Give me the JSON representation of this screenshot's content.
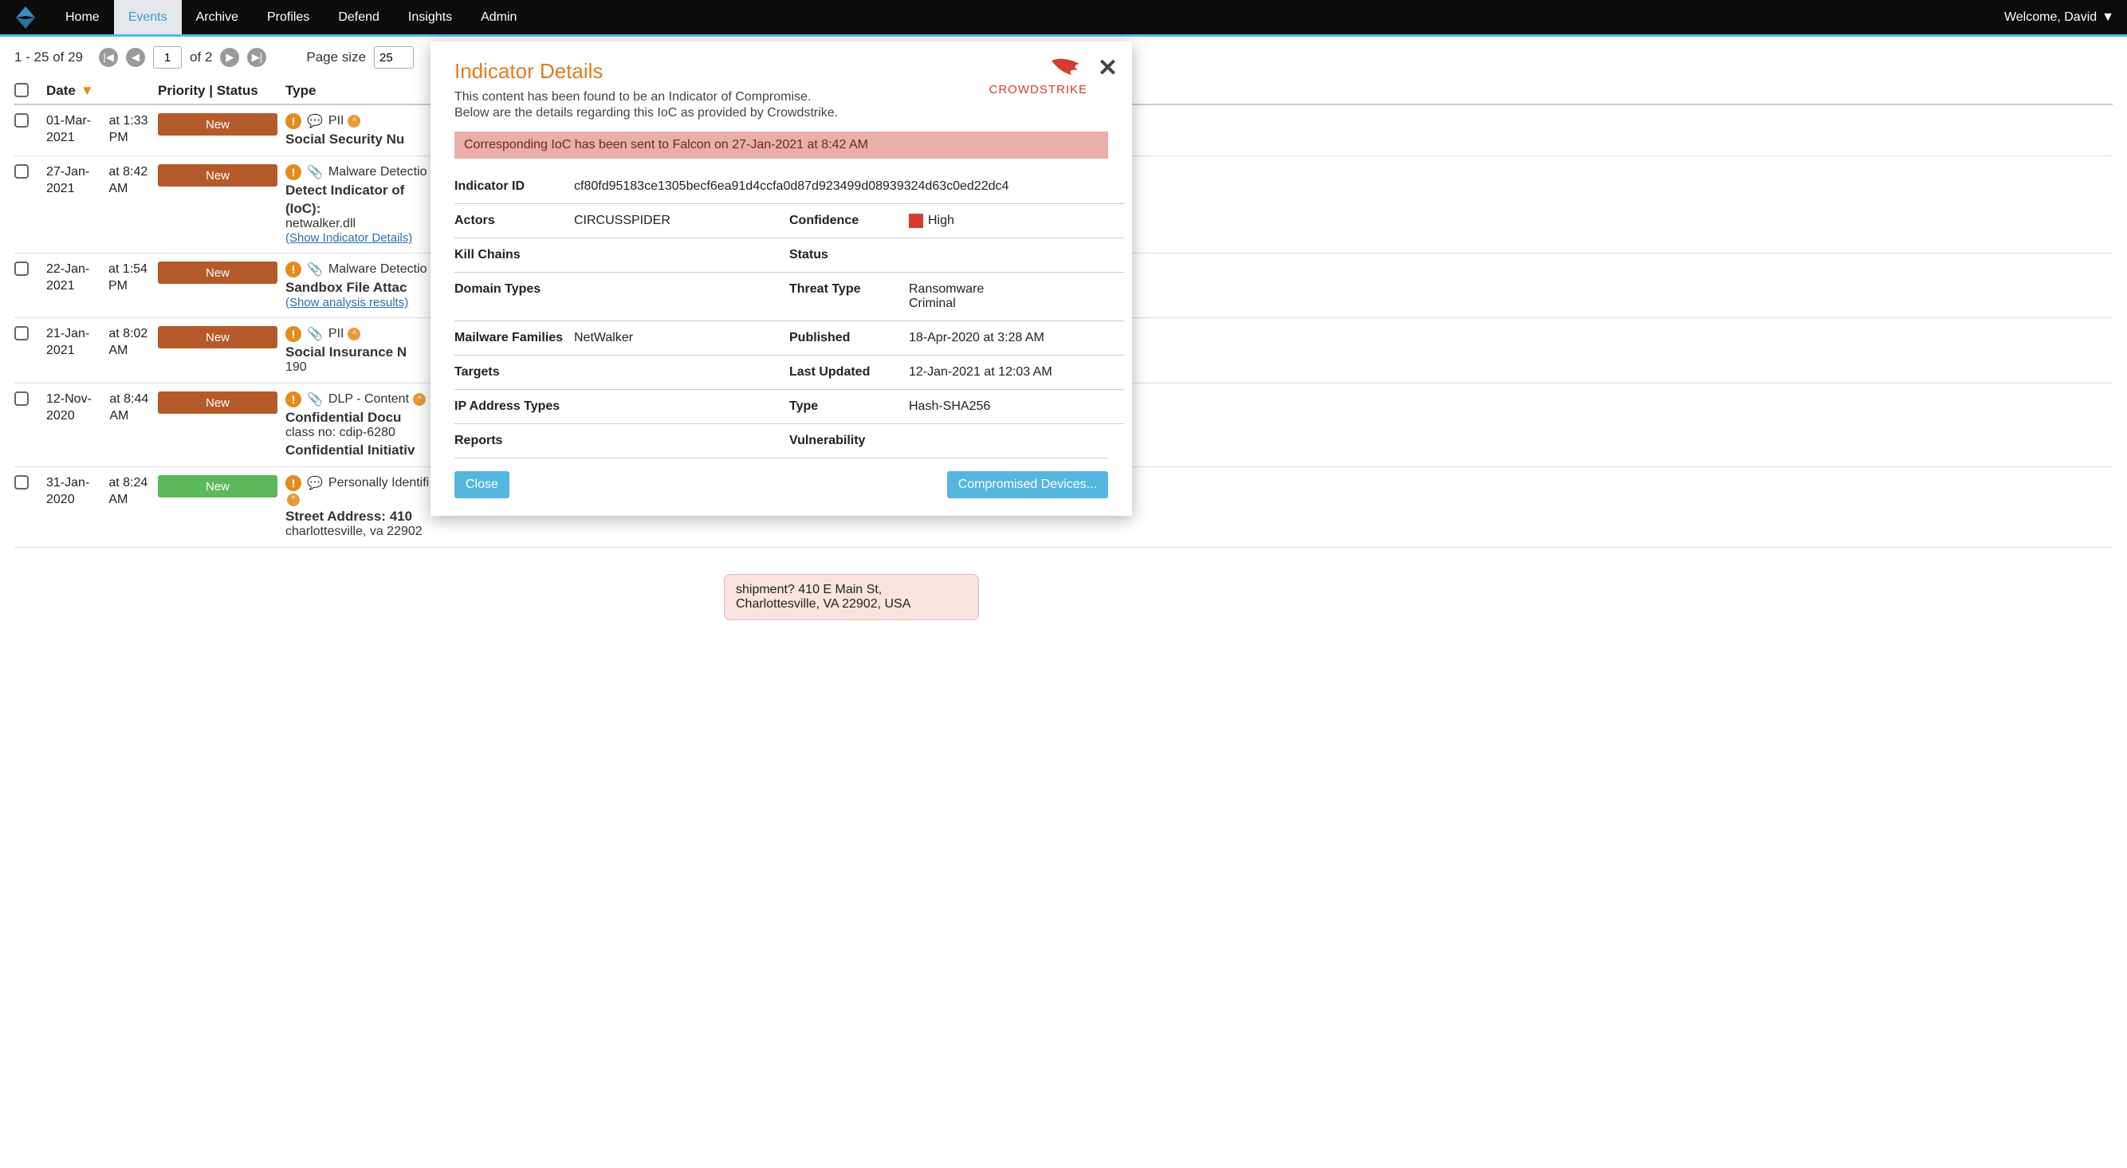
{
  "header": {
    "nav": [
      "Home",
      "Events",
      "Archive",
      "Profiles",
      "Defend",
      "Insights",
      "Admin"
    ],
    "active_nav": "Events",
    "welcome": "Welcome, David"
  },
  "pager": {
    "range": "1 - 25 of 29",
    "current_page": "1",
    "of_pages": "of 2",
    "page_size_label": "Page size",
    "page_size_value": "25"
  },
  "columns": {
    "date": "Date",
    "priority": "Priority | Status",
    "type": "Type"
  },
  "rows": [
    {
      "date1": "01-Mar-2021",
      "date2": "at 1:33 PM",
      "status": "New",
      "status_color": "brown",
      "icons": {
        "bubble": true
      },
      "tag": "PII",
      "chev": true,
      "title": "Social Security Nu",
      "line3": "",
      "link": ""
    },
    {
      "date1": "27-Jan-2021",
      "date2": "at 8:42 AM",
      "status": "New",
      "status_color": "brown",
      "icons": {
        "clip": true
      },
      "tag": "Malware Detectio",
      "title": "Detect Indicator of",
      "title2": "(IoC):",
      "line3": "netwalker.dll",
      "link": "(Show Indicator Details)"
    },
    {
      "date1": "22-Jan-2021",
      "date2": "at 1:54 PM",
      "status": "New",
      "status_color": "brown",
      "icons": {
        "clip": true
      },
      "tag": "Malware Detectio",
      "title": "Sandbox File Attac",
      "link": "(Show analysis results)"
    },
    {
      "date1": "21-Jan-2021",
      "date2": "at 8:02 AM",
      "status": "New",
      "status_color": "brown",
      "icons": {
        "clip": true
      },
      "tag": "PII",
      "chev": true,
      "title": "Social Insurance N",
      "line3": "190"
    },
    {
      "date1": "12-Nov-2020",
      "date2": "at 8:44 AM",
      "status": "New",
      "status_color": "brown",
      "icons": {
        "clip": true
      },
      "tag": "DLP - Content",
      "chev": true,
      "title": "Confidential Docu",
      "line3": "class no: cdip-6280",
      "title3": "Confidential Initiativ"
    },
    {
      "date1": "31-Jan-2020",
      "date2": "at 8:24 AM",
      "status": "New",
      "status_color": "green",
      "icons": {
        "bubble": true
      },
      "tag": "Personally Identifi",
      "chev_below": true,
      "title": "Street Address: 410",
      "line3": "charlottesville, va 22902"
    }
  ],
  "excerpt": "shipment? 410 E Main St, Charlottesville, VA 22902, USA",
  "modal": {
    "title": "Indicator Details",
    "sub1": "This content has been found to be an Indicator of Compromise.",
    "sub2": "Below are the details regarding this IoC as provided by Crowdstrike.",
    "brand": "CROWDSTRIKE",
    "banner": "Corresponding IoC has been sent to Falcon on 27-Jan-2021 at 8:42 AM",
    "details": {
      "indicator_id_label": "Indicator ID",
      "indicator_id": "cf80fd95183ce1305becf6ea91d4ccfa0d87d923499d08939324d63c0ed22dc4",
      "actors_label": "Actors",
      "actors": "CIRCUSSPIDER",
      "confidence_label": "Confidence",
      "confidence": "High",
      "kill_label": "Kill Chains",
      "kill": "",
      "status_label": "Status",
      "status": "",
      "domain_label": "Domain Types",
      "domain": "",
      "threat_label": "Threat Type",
      "threat": "Ransomware\nCriminal",
      "families_label": "Mailware Families",
      "families": "NetWalker",
      "published_label": "Published",
      "published": "18-Apr-2020 at 3:28 AM",
      "targets_label": "Targets",
      "targets": "",
      "updated_label": "Last Updated",
      "updated": "12-Jan-2021 at 12:03 AM",
      "ip_label": "IP Address Types",
      "ip": "",
      "type_label": "Type",
      "type": "Hash-SHA256",
      "reports_label": "Reports",
      "reports": "",
      "vuln_label": "Vulnerability",
      "vuln": ""
    },
    "close_btn": "Close",
    "comp_btn": "Compromised Devices..."
  }
}
